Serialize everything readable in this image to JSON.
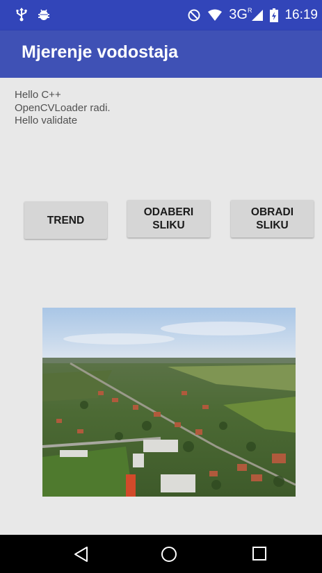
{
  "status_bar": {
    "icons": [
      "usb-icon",
      "android-debug-icon",
      "do-not-disturb-icon",
      "wifi-icon",
      "cell-signal-icon",
      "battery-charging-icon"
    ],
    "network_type": "3G",
    "roaming_flag": "R",
    "time": "16:19"
  },
  "app_bar": {
    "title": "Mjerenje vodostaja",
    "color": "#3f51b5"
  },
  "log": {
    "lines": [
      "Hello C++",
      "OpenCVLoader radi.",
      "Hello validate"
    ]
  },
  "buttons": {
    "trend": "TREND",
    "odaberi_line1": "ODABERI",
    "odaberi_line2": "SLIKU",
    "obradi_line1": "OBRADI",
    "obradi_line2": "SLIKU"
  },
  "nav_bar": {
    "icons": [
      "back-icon",
      "home-icon",
      "recents-icon"
    ]
  }
}
